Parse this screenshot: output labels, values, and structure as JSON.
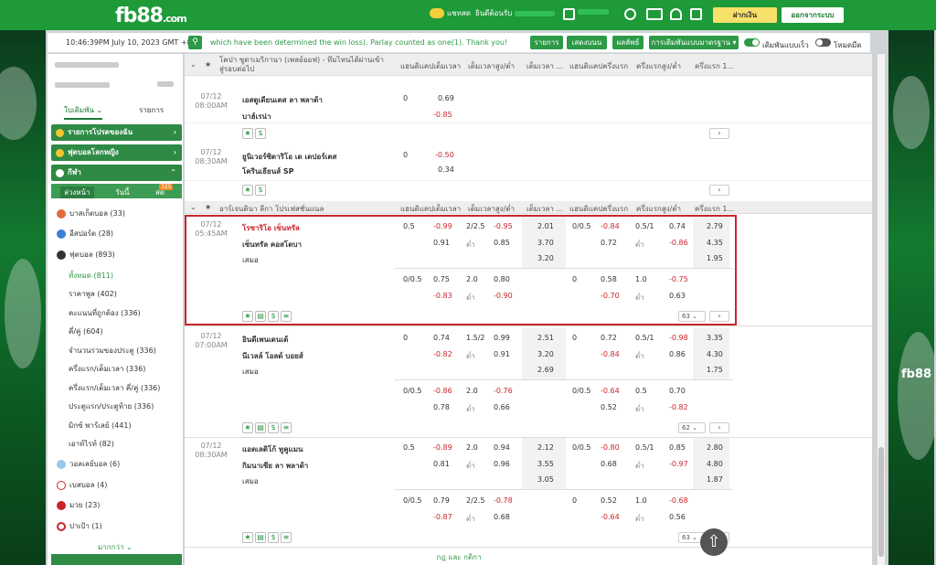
{
  "topbar": {
    "logo": "fb88",
    "logo_tld": ".com",
    "chat_label": "แชทสด",
    "welcome_label": "ยินดีต้อนรับ",
    "deposit": "ฝากเงิน",
    "logout": "ออกจากระบบ"
  },
  "ticker": {
    "time": "10:46:39PM July 10, 2023 GMT +8",
    "message": "which have been determined the win loss). Parlay counted as one(1). Thank you!",
    "btn_items": "รายการ",
    "btn_live": "เสดงบนน",
    "btn_results": "ผลลัพธ์",
    "btn_options": "การเดิมพันแบบมาตรฐาน",
    "toggle_quick": "เดิมพันแบบเร็ว",
    "toggle_dark": "โหมดมืด",
    "colors": {
      "green": "#2d9a47",
      "red": "#c9252b"
    }
  },
  "sidebar": {
    "tab_betslip": "ใบเดิมพัน",
    "tab_list": "รายการ",
    "sec1": "รายการโปรดของฉัน",
    "sec2": "ฟุตบอลโลกหญิง",
    "sec3": "กีฬา",
    "sub_upcoming": "ล่วงหน้า",
    "sub_today": "วันนี้",
    "sub_live": "สด",
    "live_count": "325",
    "sports": [
      {
        "label": "บาสเก็ตบอล (33)",
        "icon": "basketball-icon"
      },
      {
        "label": "อีสปอร์ต (28)",
        "icon": "esports-icon"
      },
      {
        "label": "ฟุตบอล (893)",
        "icon": "soccer-icon"
      }
    ],
    "football_sub": [
      "ทั้งหมด (811)",
      "ราคาพูล (402)",
      "คะแนนที่ถูกต้อง (336)",
      "คี่/คู่ (604)",
      "จำนวนรวมของประตู (336)",
      "ครึ่งแรก/เต็มเวลา (336)",
      "ครึ่งแรก/เต็มเวลา คี่/คู่ (336)",
      "ประตูแรก/ประตูท้าย (336)",
      "มิกซ์ พาร์เลย์ (441)",
      "เอาท์ไรท์ (82)"
    ],
    "sports2": [
      {
        "label": "วอลเลย์บอล (6)",
        "icon": "volleyball-icon"
      },
      {
        "label": "เบสบอล (4)",
        "icon": "baseball-icon"
      },
      {
        "label": "มวย (23)",
        "icon": "boxing-icon"
      },
      {
        "label": "ปาเป้า (1)",
        "icon": "darts-icon"
      }
    ],
    "more": "มากกว่า"
  },
  "main": {
    "league1": "โคปา ซูดาเมริกานา (เพลย์ออฟ) - ทีมไหนได้ผ่านเข้าสู่รอบต่อไป",
    "league2": "อาร์เจนตินา ลีกา โปรเฟสชั่นแนล",
    "cols": [
      "แฮนดิแคปเต็มเวลา",
      "เต็มเวลาสูง/ต่ำ",
      "เต็มเวลา ...",
      "แฮนดิแคปครึ่งแรก",
      "ครึ่งแรกสูง/ต่ำ",
      "ครึ่งแรก 1..."
    ],
    "m1": {
      "date": "07/12",
      "time": "08:00AM",
      "home": "เอสตูเดียนเตส ลา พลาต้า",
      "away": "บาฮ์เรน่า",
      "hdp": "0",
      "o1": "0.69",
      "o2": "-0.85"
    },
    "m2": {
      "date": "07/12",
      "time": "08:30AM",
      "home": "ยูนิเวอร์ซิดาริโอ เด เดปอร์เตส",
      "away": "โครินเธียนส์ SP",
      "hdp": "0",
      "o1": "-0.50",
      "o2": "0.34"
    },
    "m3": {
      "date": "07/12",
      "time": "05:45AM",
      "home": "โรซาริโอ เซ็นทรัล",
      "away": "เซ็นทรัล คอสโดบา",
      "draw": "เสมอ",
      "r1": [
        "0.5",
        "-0.99",
        "2/2.5",
        "-0.95",
        "2.01",
        "0/0.5",
        "-0.84",
        "0.5/1",
        "0.74",
        "2.79"
      ],
      "r2": [
        "0.91",
        "ต่ำ",
        "0.85",
        "3.70",
        "0.72",
        "ต่ำ",
        "-0.86",
        "4.35"
      ],
      "r3": [
        "3.20",
        "1.95"
      ],
      "r4": [
        "0/0.5",
        "0.75",
        "2.0",
        "0.80",
        "0",
        "0.58",
        "1.0",
        "-0.75"
      ],
      "r5": [
        "-0.83",
        "ต่ำ",
        "-0.90",
        "-0.70",
        "ต่ำ",
        "0.63"
      ],
      "more": "63"
    },
    "m4": {
      "date": "07/12",
      "time": "07:00AM",
      "home": "อินดีเพนเดนเต้",
      "away": "นีเวลล์ โอลด์ บอยส์",
      "draw": "เสมอ",
      "r1": [
        "0",
        "0.74",
        "1.5/2",
        "0.99",
        "2.51",
        "0",
        "0.72",
        "0.5/1",
        "-0.98",
        "3.35"
      ],
      "r2": [
        "-0.82",
        "ต่ำ",
        "0.91",
        "3.20",
        "-0.84",
        "ต่ำ",
        "0.86",
        "4.30"
      ],
      "r3": [
        "2.69",
        "1.75"
      ],
      "r4": [
        "0/0.5",
        "-0.86",
        "2.0",
        "-0.76",
        "0/0.5",
        "-0.64",
        "0.5",
        "0.70"
      ],
      "r5": [
        "0.78",
        "ต่ำ",
        "0.66",
        "0.52",
        "ต่ำ",
        "-0.82"
      ],
      "more": "62"
    },
    "m5": {
      "date": "07/12",
      "time": "08:30AM",
      "home": "แอตเลติโก้ ทูคูแมน",
      "away": "กิมนาเซีย ลา พลาต้า",
      "draw": "เสมอ",
      "r1": [
        "0.5",
        "-0.89",
        "2.0",
        "0.94",
        "2.12",
        "0/0.5",
        "-0.80",
        "0.5/1",
        "0.85",
        "2.80"
      ],
      "r2": [
        "0.81",
        "ต่ำ",
        "0.96",
        "3.55",
        "0.68",
        "ต่ำ",
        "-0.97",
        "4.80"
      ],
      "r3": [
        "3.05",
        "1.87"
      ],
      "r4": [
        "0/0.5",
        "0.79",
        "2/2.5",
        "-0.78",
        "0",
        "0.52",
        "1.0",
        "-0.68"
      ],
      "r5": [
        "-0.87",
        "ต่ำ",
        "0.68",
        "-0.64",
        "ต่ำ",
        "0.56"
      ],
      "more": "63"
    },
    "footer": "กฎ และ กติกา"
  }
}
